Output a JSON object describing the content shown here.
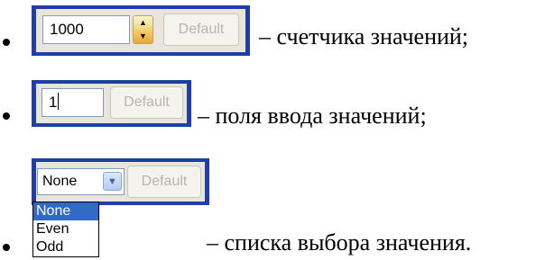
{
  "rows": [
    {
      "widget": "spinner",
      "value": "1000",
      "button_label": "Default",
      "description": "– счетчика значений;"
    },
    {
      "widget": "text-field",
      "value": "1",
      "button_label": "Default",
      "description": "– поля ввода значений;"
    },
    {
      "widget": "select",
      "selected": "None",
      "button_label": "Default",
      "options": [
        "None",
        "Even",
        "Odd"
      ],
      "highlighted_option": "None",
      "description": "– списка выбора значения."
    }
  ],
  "colors": {
    "frame": "#1f3fa8",
    "panel": "#e9e5dd",
    "highlight": "#316ac5",
    "disabled_text": "#b9b6a8"
  },
  "icons": {
    "spinner_up": "triangle-up",
    "spinner_down": "triangle-down",
    "select_arrow": "chevron-down",
    "bullet": "disc"
  }
}
